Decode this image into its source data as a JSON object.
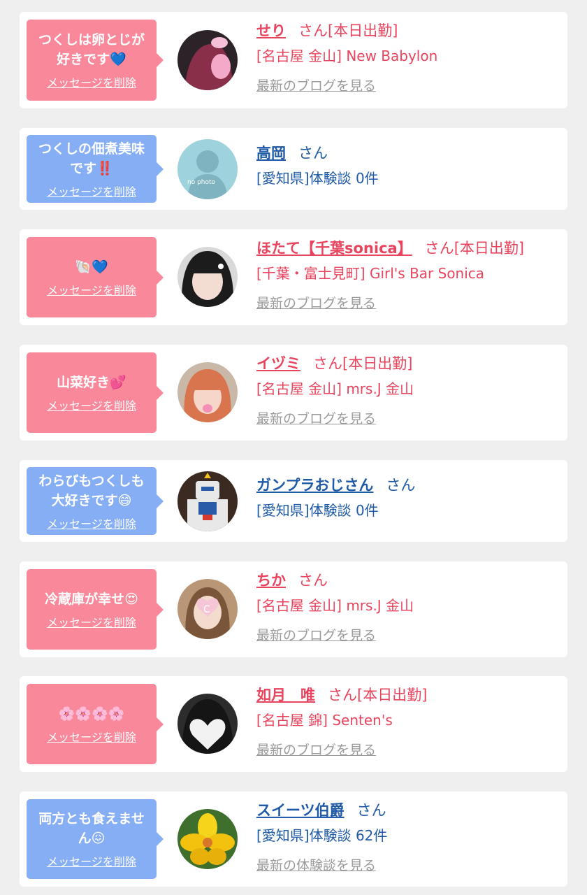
{
  "colors": {
    "pink_text": "#e8445e",
    "blue_text": "#1f5aa6",
    "pink_bubble": "#f8889a",
    "blue_bubble": "#86aef5",
    "link_gray": "#9a9a9a"
  },
  "items": [
    {
      "bubble_text": "つくしは卵とじが\n好きです💙",
      "delete_label": "メッセージを削除",
      "name": "せり",
      "suffix": "さん[本日出勤]",
      "shop": "[名古屋 金山] New Babylon",
      "blog": "最新のブログを見る"
    },
    {
      "bubble_text": "つくしの佃煮美味\nです‼️",
      "delete_label": "メッセージを削除",
      "name": "高岡",
      "suffix": "さん",
      "shop": "[愛知県]体験談 0件",
      "avatar_text": "no photo"
    },
    {
      "bubble_text": "🐚💙",
      "delete_label": "メッセージを削除",
      "name": "ほたて【千葉sonica】",
      "suffix": "さん[本日出勤]",
      "shop": "[千葉・富士見町] Girl's Bar Sonica",
      "blog": "最新のブログを見る"
    },
    {
      "bubble_text": "山菜好き💕",
      "delete_label": "メッセージを削除",
      "name": "イヅミ",
      "suffix": "さん[本日出勤]",
      "shop": "[名古屋 金山] mrs.J 金山",
      "blog": "最新のブログを見る"
    },
    {
      "bubble_text": "わらびもつくしも\n大好きです😄",
      "delete_label": "メッセージを削除",
      "name": "ガンプラおじさん",
      "suffix": "さん",
      "shop": "[愛知県]体験談 0件"
    },
    {
      "bubble_text": "冷蔵庫が幸せ😍",
      "delete_label": "メッセージを削除",
      "name": "ちか",
      "suffix": "さん",
      "shop": "[名古屋 金山] mrs.J 金山",
      "blog": "最新のブログを見る"
    },
    {
      "bubble_text": "🌸🌸🌸🌸",
      "delete_label": "メッセージを削除",
      "name": "如月　唯",
      "suffix": "さん[本日出勤]",
      "shop": "[名古屋 錦] Senten's",
      "blog": "最新のブログを見る"
    },
    {
      "bubble_text": "両方とも食えませ\nん😖",
      "delete_label": "メッセージを削除",
      "name": "スイーツ伯爵",
      "suffix": "さん",
      "shop": "[愛知県]体験談 62件",
      "blog": "最新の体験談を見る"
    }
  ]
}
